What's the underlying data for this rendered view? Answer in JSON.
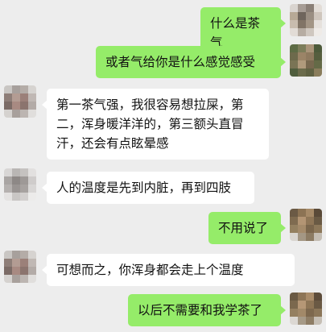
{
  "colors": {
    "background": "#ededed",
    "outgoing_bubble": "#95ec69",
    "incoming_bubble": "#ffffff"
  },
  "messages": [
    {
      "side": "out",
      "text": "什么是茶气"
    },
    {
      "side": "out",
      "text": "或者气给你是什么感觉感受"
    },
    {
      "side": "in",
      "text": "第一茶气强，我很容易想拉屎，第二，浑身暖洋洋的，第三额头直冒汗，还会有点眩晕感"
    },
    {
      "side": "in",
      "text": "人的温度是先到内脏，再到四肢"
    },
    {
      "side": "out",
      "text": "不用说了"
    },
    {
      "side": "in",
      "text": "可想而之，你浑身都会走上个温度"
    },
    {
      "side": "out",
      "text": "以后不需要和我学茶了"
    }
  ],
  "avatars": {
    "me": "blurred-avatar",
    "other": "blurred-avatar"
  }
}
